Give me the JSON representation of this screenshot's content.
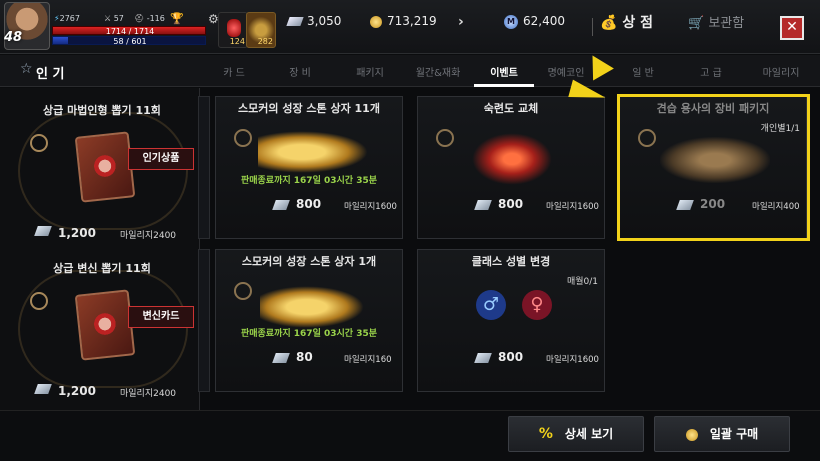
{
  "player": {
    "level": "48",
    "power": "2767",
    "stat_a": "57",
    "stat_b": "-116",
    "hp_text": "1714 / 1714",
    "mp_text": "58 / 601",
    "hp_ratio": 1.0,
    "mp_ratio": 0.0965
  },
  "quick_items": [
    {
      "name": "potion-icon",
      "count": "124"
    },
    {
      "name": "feather-icon",
      "count": "282"
    }
  ],
  "currency": {
    "mileage": "3,050",
    "gold": "713,219",
    "m_coin": "62,400"
  },
  "header": {
    "shop_label": "상 점",
    "storage_label": "보관함",
    "close_symbol": "✕"
  },
  "tabs": {
    "popular_label": "인 기",
    "items": [
      "카 드",
      "장 비",
      "패키지",
      "월간&재화",
      "이벤트",
      "명예코인",
      "일 반",
      "고 급",
      "마일리지"
    ],
    "active": "이벤트"
  },
  "left_cards": [
    {
      "title": "상급 마법인형 뽑기 11회",
      "tag": "인기상품",
      "price": "1,200",
      "mileage": "마일리지2400"
    },
    {
      "title": "상급 변신 뽑기 11회",
      "tag": "변신카드",
      "price": "1,200",
      "mileage": "마일리지2400"
    }
  ],
  "products": [
    {
      "title": "스모커의 성장 스톤 상자 11개",
      "timer": "판매종료까지 167일 03시간 35분",
      "price": "800",
      "mileage": "마일리지1600",
      "limit": ""
    },
    {
      "title": "숙련도 교체",
      "timer": "",
      "price": "800",
      "mileage": "마일리지1600",
      "limit": ""
    },
    {
      "title": "견습 용사의 장비 패키지",
      "timer": "",
      "price": "200",
      "mileage": "마일리지400",
      "limit": "개인별1/1"
    },
    {
      "title": "스모커의 성장 스톤 상자 1개",
      "timer": "판매종료까지 167일 03시간 35분",
      "price": "80",
      "mileage": "마일리지160",
      "limit": ""
    },
    {
      "title": "클래스 성별 변경",
      "timer": "",
      "price": "800",
      "mileage": "마일리지1600",
      "limit": "매월0/1"
    }
  ],
  "bottom": {
    "detail_icon": "%",
    "detail_label": "상세 보기",
    "buy_all_label": "일괄 구매"
  },
  "colors": {
    "highlight": "#f2d21a",
    "timer_green": "#9ad34a",
    "hp_red": "#d22222",
    "mp_blue": "#2a4fd0"
  }
}
